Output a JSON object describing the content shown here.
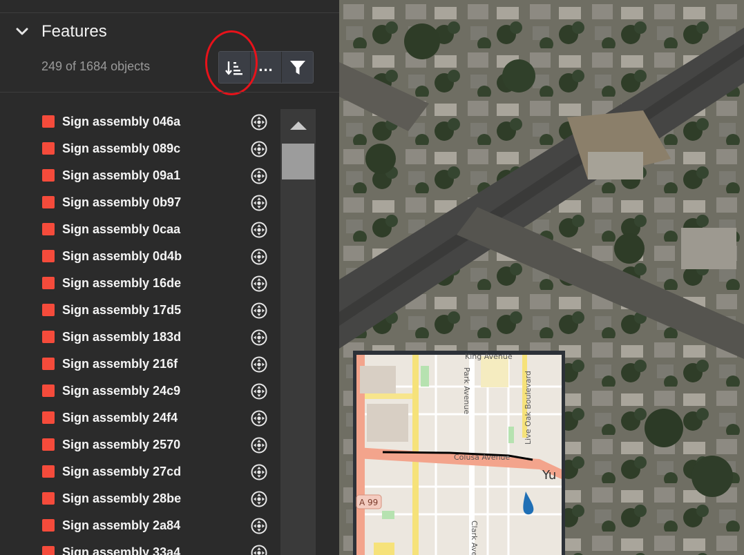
{
  "features_panel": {
    "title": "Features",
    "count_text": "249 of 1684 objects",
    "toolbar": {
      "sort_icon": "sort-descending-icon",
      "more_label": "...",
      "filter_icon": "filter-icon"
    },
    "items": [
      {
        "label": "Sign assembly 046a"
      },
      {
        "label": "Sign assembly 089c"
      },
      {
        "label": "Sign assembly 09a1"
      },
      {
        "label": "Sign assembly 0b97"
      },
      {
        "label": "Sign assembly 0caa"
      },
      {
        "label": "Sign assembly 0d4b"
      },
      {
        "label": "Sign assembly 16de"
      },
      {
        "label": "Sign assembly 17d5"
      },
      {
        "label": "Sign assembly 183d"
      },
      {
        "label": "Sign assembly 216f"
      },
      {
        "label": "Sign assembly 24c9"
      },
      {
        "label": "Sign assembly 24f4"
      },
      {
        "label": "Sign assembly 2570"
      },
      {
        "label": "Sign assembly 27cd"
      },
      {
        "label": "Sign assembly 28be"
      },
      {
        "label": "Sign assembly 2a84"
      },
      {
        "label": "Sign assembly 33a4"
      }
    ],
    "colors": {
      "feature_swatch": "#f54b3b",
      "highlight_ring": "#e8121a"
    }
  },
  "overview_map": {
    "labels": {
      "king_ave": "King Avenue",
      "park_ave": "Park Avenue",
      "live_oak": "Live Oak Boulevard",
      "colusa": "Colusa Avenue",
      "city": "Yu",
      "route": "A 99",
      "clark": "Clark Ave"
    }
  }
}
